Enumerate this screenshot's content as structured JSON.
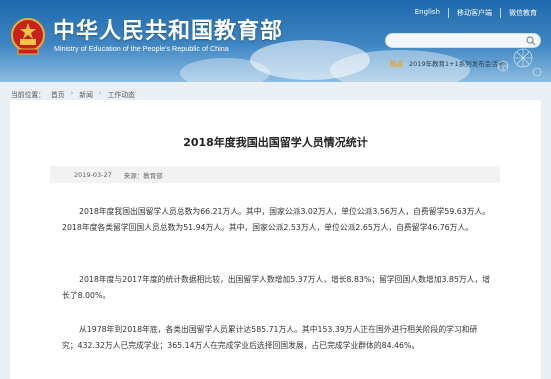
{
  "header": {
    "site_title": "中华人民共和国教育部",
    "site_subtitle": "Ministry of Education of the People's Republic of China",
    "top_links": [
      "English",
      "移动客户端",
      "微信教育"
    ],
    "news_label": "热点",
    "news_text": "2019年教育1+1系列发布会活动"
  },
  "breadcrumb": {
    "label": "当前位置：",
    "items": [
      "首页",
      "新闻",
      "工作动态"
    ]
  },
  "article": {
    "title": "2018年度我国出国留学人员情况统计",
    "date": "2019-03-27",
    "source": "来源：教育部",
    "paragraphs": [
      "2018年度我国出国留学人员总数为66.21万人。其中，国家公派3.02万人，单位公派3.56万人，自费留学59.63万人。2018年度各类留学回国人员总数为51.94万人。其中，国家公派2.53万人，单位公派2.65万人，自费留学46.76万人。",
      "2018年度与2017年度的统计数据相比较，出国留学人数增加5.37万人，增长8.83%；留学回国人数增加3.85万人，增长了8.00%。",
      "从1978年到2018年底，各类出国留学人员累计达585.71万人。其中153.39万人正在国外进行相关阶段的学习和研究；432.32万人已完成学业；365.14万人在完成学业后选择回国发展，占已完成学业群体的84.46%。"
    ]
  }
}
